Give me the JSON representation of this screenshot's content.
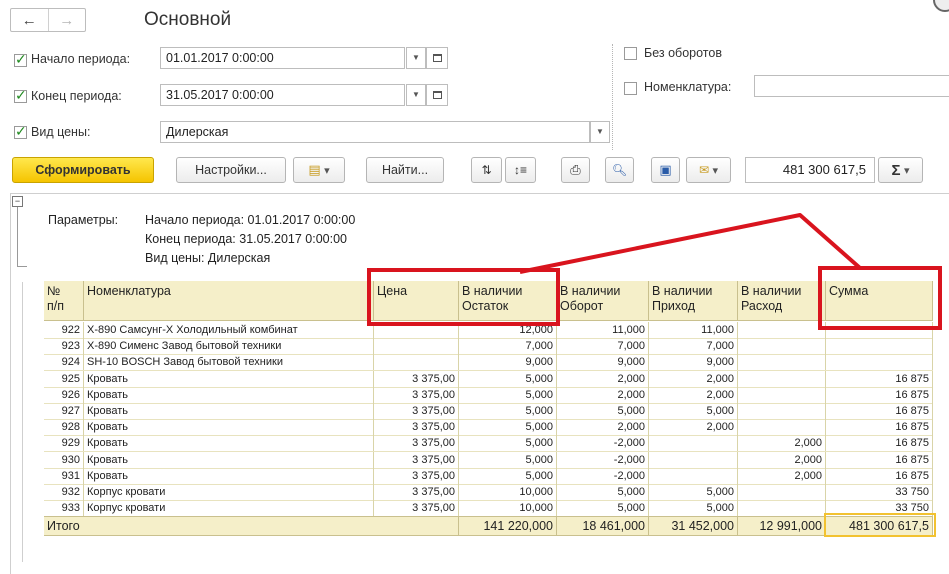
{
  "window": {
    "title": "Основной"
  },
  "form": {
    "period_start": {
      "label": "Начало периода:",
      "value": "01.01.2017  0:00:00"
    },
    "period_end": {
      "label": "Конец периода:",
      "value": "31.05.2017  0:00:00"
    },
    "price_type": {
      "label": "Вид цены:",
      "value": "Дилерская"
    },
    "no_turnover": {
      "label": "Без оборотов"
    },
    "nomenclature": {
      "label": "Номенклатура:",
      "value": ""
    }
  },
  "toolbar": {
    "generate": "Сформировать",
    "settings": "Настройки...",
    "find": "Найти...",
    "sum_value": "481 300 617,5",
    "sigma": "Σ"
  },
  "params": {
    "label": "Параметры:",
    "lines": [
      "Начало периода: 01.01.2017 0:00:00",
      "Конец периода: 31.05.2017 0:00:00",
      "Вид цены: Дилерская"
    ]
  },
  "table": {
    "headers": {
      "num": "№\nп/п",
      "name": "Номенклатура",
      "price": "Цена",
      "stock": "В наличии\nОстаток",
      "turnover": "В наличии\nОборот",
      "income": "В наличии\nПриход",
      "expense": "В наличии\nРасход",
      "sum": "Сумма"
    },
    "rows": [
      {
        "num": "922",
        "name": "X-890 Самсунг-X Холодильный комбинат",
        "price": "",
        "stock": "12,000",
        "turnover": "11,000",
        "income": "11,000",
        "expense": "",
        "sum": ""
      },
      {
        "num": "923",
        "name": "X-890 Сименс Завод бытовой техники",
        "price": "",
        "stock": "7,000",
        "turnover": "7,000",
        "income": "7,000",
        "expense": "",
        "sum": ""
      },
      {
        "num": "924",
        "name": "SH-10 BOSCH Завод бытовой техники",
        "price": "",
        "stock": "9,000",
        "turnover": "9,000",
        "income": "9,000",
        "expense": "",
        "sum": ""
      },
      {
        "num": "925",
        "name": "Кровать",
        "price": "3 375,00",
        "stock": "5,000",
        "turnover": "2,000",
        "income": "2,000",
        "expense": "",
        "sum": "16 875"
      },
      {
        "num": "926",
        "name": "Кровать",
        "price": "3 375,00",
        "stock": "5,000",
        "turnover": "2,000",
        "income": "2,000",
        "expense": "",
        "sum": "16 875"
      },
      {
        "num": "927",
        "name": "Кровать",
        "price": "3 375,00",
        "stock": "5,000",
        "turnover": "5,000",
        "income": "5,000",
        "expense": "",
        "sum": "16 875"
      },
      {
        "num": "928",
        "name": "Кровать",
        "price": "3 375,00",
        "stock": "5,000",
        "turnover": "2,000",
        "income": "2,000",
        "expense": "",
        "sum": "16 875"
      },
      {
        "num": "929",
        "name": "Кровать",
        "price": "3 375,00",
        "stock": "5,000",
        "turnover": "-2,000",
        "income": "",
        "expense": "2,000",
        "sum": "16 875"
      },
      {
        "num": "930",
        "name": "Кровать",
        "price": "3 375,00",
        "stock": "5,000",
        "turnover": "-2,000",
        "income": "",
        "expense": "2,000",
        "sum": "16 875"
      },
      {
        "num": "931",
        "name": "Кровать",
        "price": "3 375,00",
        "stock": "5,000",
        "turnover": "-2,000",
        "income": "",
        "expense": "2,000",
        "sum": "16 875"
      },
      {
        "num": "932",
        "name": "Корпус кровати",
        "price": "3 375,00",
        "stock": "10,000",
        "turnover": "5,000",
        "income": "5,000",
        "expense": "",
        "sum": "33 750"
      },
      {
        "num": "933",
        "name": "Корпус кровати",
        "price": "3 375,00",
        "stock": "10,000",
        "turnover": "5,000",
        "income": "5,000",
        "expense": "",
        "sum": "33 750"
      }
    ],
    "total": {
      "label": "Итого",
      "stock": "141 220,000",
      "turnover": "18 461,000",
      "income": "31 452,000",
      "expense": "12 991,000",
      "sum": "481 300 617,5"
    }
  },
  "colors": {
    "accent_yellow": "#f5c400",
    "annotation_red": "#d9141e",
    "header_bg": "#f5efc9"
  }
}
